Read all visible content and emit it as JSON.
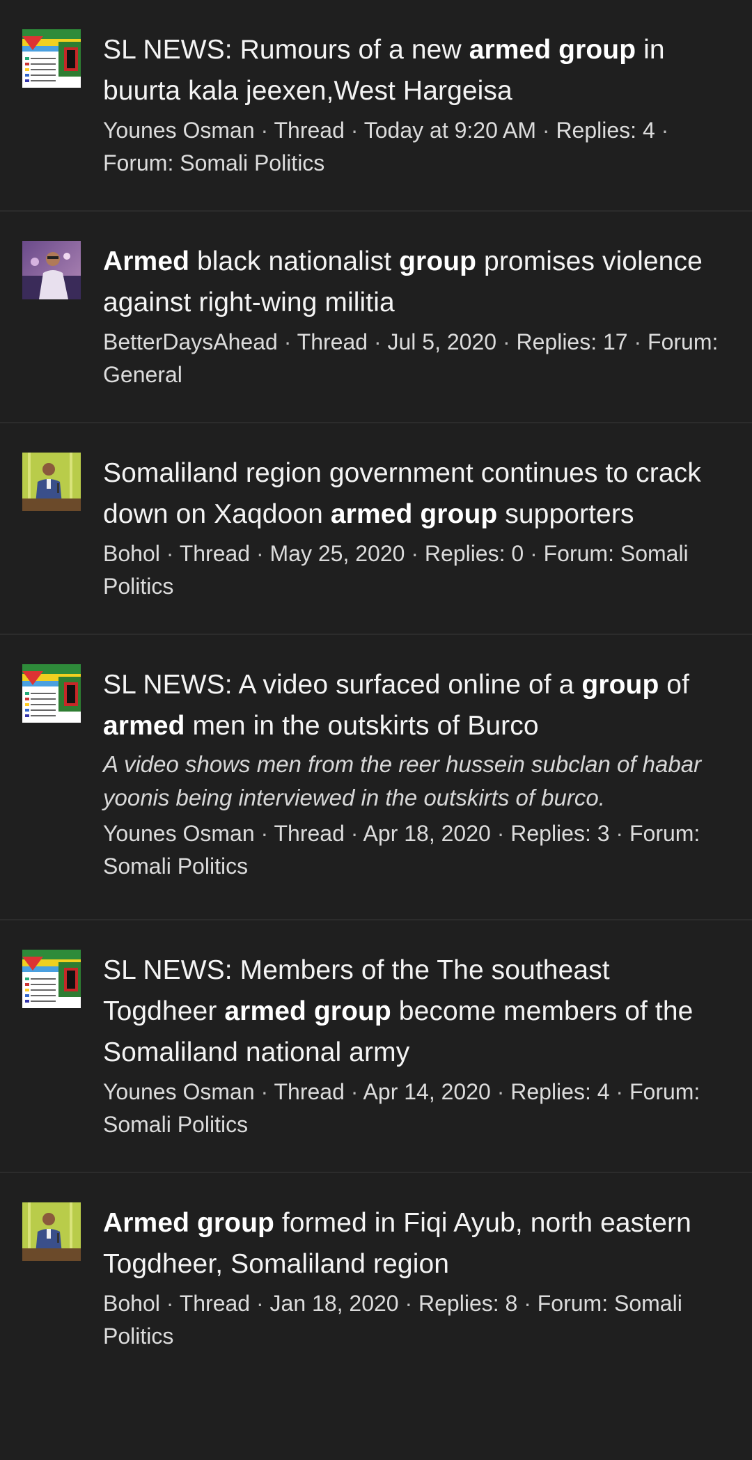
{
  "results": [
    {
      "avatar": "flag-collage",
      "title": [
        {
          "t": "SL NEWS: Rumours of a new ",
          "b": false
        },
        {
          "t": "armed group",
          "b": true
        },
        {
          "t": " in buurta kala jeexen,West Hargeisa",
          "b": false
        }
      ],
      "snippet": "",
      "author": "Younes Osman",
      "type": "Thread",
      "date": "Today at 9:20 AM",
      "replies": "Replies: 4",
      "forum": "Forum: Somali Politics"
    },
    {
      "avatar": "person-purple",
      "title": [
        {
          "t": "Armed",
          "b": true
        },
        {
          "t": " black nationalist ",
          "b": false
        },
        {
          "t": "group",
          "b": true
        },
        {
          "t": " promises violence against right-wing militia",
          "b": false
        }
      ],
      "snippet": "",
      "author": "BetterDaysAhead",
      "type": "Thread",
      "date": "Jul 5, 2020",
      "replies": "Replies: 17",
      "forum": "Forum: General"
    },
    {
      "avatar": "speaker-podium",
      "title": [
        {
          "t": "Somaliland region government continues to crack down on Xaqdoon ",
          "b": false
        },
        {
          "t": "armed group",
          "b": true
        },
        {
          "t": " supporters",
          "b": false
        }
      ],
      "snippet": "",
      "author": "Bohol",
      "type": "Thread",
      "date": "May 25, 2020",
      "replies": "Replies: 0",
      "forum": "Forum: Somali Politics"
    },
    {
      "avatar": "flag-collage",
      "title": [
        {
          "t": "SL NEWS: A video surfaced online of a ",
          "b": false
        },
        {
          "t": "group",
          "b": true
        },
        {
          "t": " of ",
          "b": false
        },
        {
          "t": "armed",
          "b": true
        },
        {
          "t": " men in the outskirts of Burco",
          "b": false
        }
      ],
      "snippet": "A video shows men from the reer hussein subclan of habar yoonis being interviewed in the outskirts of burco.",
      "author": "Younes Osman",
      "type": "Thread",
      "date": "Apr 18, 2020",
      "replies": "Replies: 3",
      "forum": "Forum: Somali Politics"
    },
    {
      "avatar": "flag-collage",
      "title": [
        {
          "t": "SL NEWS: Members of the The southeast Togdheer ",
          "b": false
        },
        {
          "t": "armed group",
          "b": true
        },
        {
          "t": " become members of the Somaliland national army",
          "b": false
        }
      ],
      "snippet": "",
      "author": "Younes Osman",
      "type": "Thread",
      "date": "Apr 14, 2020",
      "replies": "Replies: 4",
      "forum": "Forum: Somali Politics"
    },
    {
      "avatar": "speaker-podium",
      "title": [
        {
          "t": "Armed group",
          "b": true
        },
        {
          "t": " formed in Fiqi Ayub, north eastern Togdheer, Somaliland region",
          "b": false
        }
      ],
      "snippet": "",
      "author": "Bohol",
      "type": "Thread",
      "date": "Jan 18, 2020",
      "replies": "Replies: 8",
      "forum": "Forum: Somali Politics"
    }
  ],
  "meta_separator": " · "
}
